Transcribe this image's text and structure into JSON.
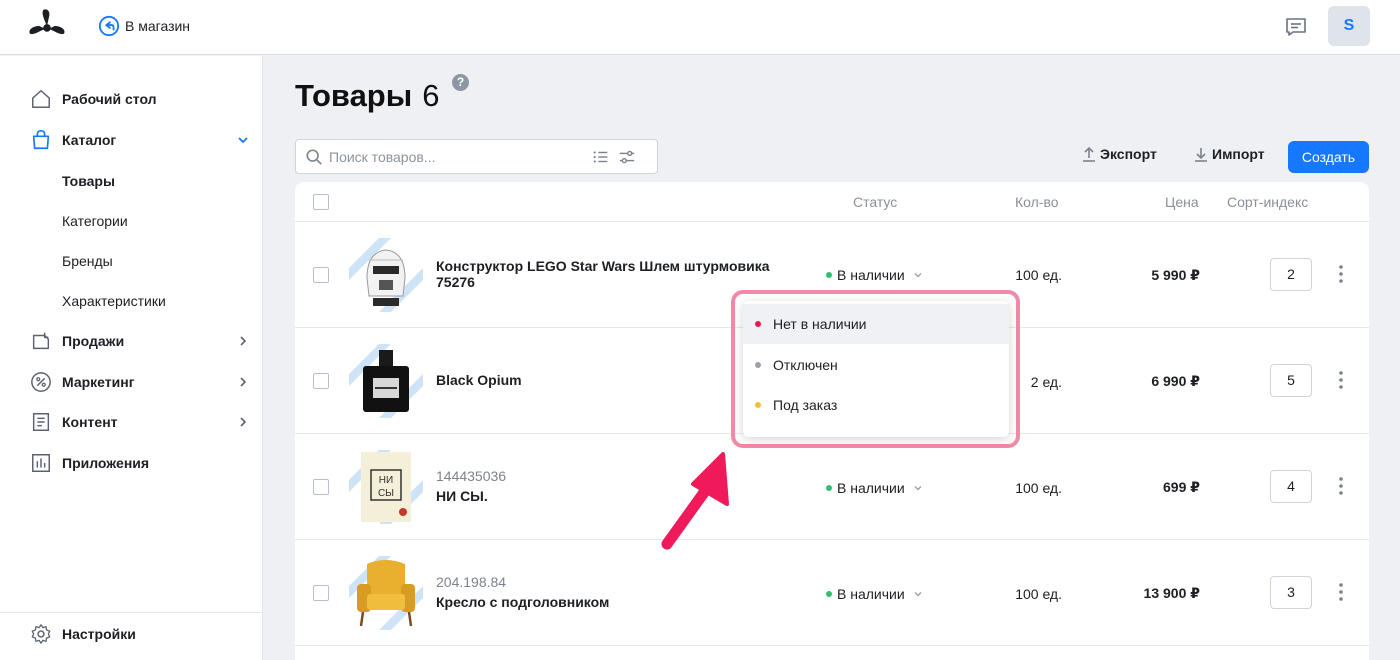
{
  "header": {
    "store_link": "В магазин",
    "avatar_letter": "S"
  },
  "sidebar": {
    "items": [
      {
        "label": "Рабочий стол",
        "icon": "home-icon"
      },
      {
        "label": "Каталог",
        "icon": "shopping-bag-icon"
      },
      {
        "label": "Продажи",
        "icon": "sales-icon"
      },
      {
        "label": "Маркетинг",
        "icon": "percent-icon"
      },
      {
        "label": "Контент",
        "icon": "document-icon"
      },
      {
        "label": "Приложения",
        "icon": "apps-icon"
      }
    ],
    "catalog_sub": [
      "Товары",
      "Категории",
      "Бренды",
      "Характеристики"
    ],
    "settings": "Настройки"
  },
  "page": {
    "title": "Товары",
    "count": "6",
    "help": "?"
  },
  "toolbar": {
    "search_placeholder": "Поиск товаров...",
    "export": "Экспорт",
    "import": "Импорт",
    "create": "Создать"
  },
  "table": {
    "columns": {
      "status": "Статус",
      "qty": "Кол-во",
      "price": "Цена",
      "sort": "Сорт-индекс"
    },
    "rows": [
      {
        "sku": "",
        "name_line1": "Конструктор LEGO Star Wars Шлем штурмовика",
        "name_line2": "75276",
        "status": "В наличии",
        "qty": "100 ед.",
        "price": "5 990 ₽",
        "sort": "2"
      },
      {
        "sku": "",
        "name_line1": "Black Opium",
        "name_line2": "",
        "status": "",
        "qty": "2 ед.",
        "price": "6 990 ₽",
        "sort": "5"
      },
      {
        "sku": "144435036",
        "name_line1": "НИ СЫ.",
        "name_line2": "",
        "status": "В наличии",
        "qty": "100 ед.",
        "price": "699 ₽",
        "sort": "4"
      },
      {
        "sku": "204.198.84",
        "name_line1": "Кресло с подголовником",
        "name_line2": "",
        "status": "В наличии",
        "qty": "100 ед.",
        "price": "13 900 ₽",
        "sort": "3"
      }
    ]
  },
  "status_dropdown": {
    "options": [
      {
        "label": "Нет в наличии",
        "color": "#e8194f"
      },
      {
        "label": "Отключен",
        "color": "#9aa0ab"
      },
      {
        "label": "Под заказ",
        "color": "#f2c037"
      }
    ]
  },
  "colors": {
    "accent": "#1677ff",
    "in_stock": "#2fbf71",
    "highlight": "#f08aa6",
    "arrow": "#f0195a"
  }
}
